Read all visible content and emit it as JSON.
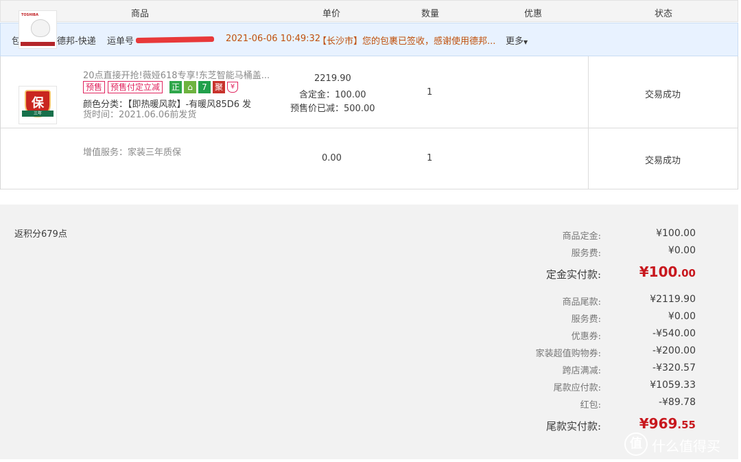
{
  "header": {
    "product": "商品",
    "unit_price": "单价",
    "quantity": "数量",
    "discount": "优惠",
    "status": "状态"
  },
  "package": {
    "name": "包裹1",
    "carrier": "德邦-快递",
    "tracking_label": "运单号",
    "time": "2021-06-06 10:49:32",
    "message": "【长沙市】您的包裹已签收，感谢使用德邦...",
    "more": "更多"
  },
  "items": [
    {
      "title": "20点直接开抢!薇娅618专享!东芝智能马桶盖...",
      "thumb_brand": "TOSHIBA",
      "tags": [
        "预售",
        "预售付定立减"
      ],
      "badges": [
        {
          "text": "正",
          "color": "#2ea64a"
        },
        {
          "text": "⌂",
          "color": "#6db33f"
        },
        {
          "text": "7",
          "color": "#21a04b"
        },
        {
          "text": "聚",
          "color": "#c8332c"
        }
      ],
      "attr_line1": "颜色分类：【即热暖风款】-有暖风85D6 发",
      "attr_line2": "货时间：2021.06.06前发货",
      "price": "2219.90",
      "deposit": "含定金：100.00",
      "presale_off": "预售价已减：500.00",
      "quantity": "1",
      "status": "交易成功"
    },
    {
      "service": "增值服务：家装三年质保",
      "thumb_char": "保",
      "thumb_ribbon": "三年",
      "price": "0.00",
      "quantity": "1",
      "status": "交易成功"
    }
  ],
  "summary": {
    "points": "返积分679点",
    "deposit_goods_label": "商品定金:",
    "deposit_goods_value": "¥100.00",
    "service_fee1_label": "服务费:",
    "service_fee1_value": "¥0.00",
    "deposit_paid_label": "定金实付款:",
    "deposit_paid_int": "¥100",
    "deposit_paid_dec": ".00",
    "balance_goods_label": "商品尾款:",
    "balance_goods_value": "¥2119.90",
    "service_fee2_label": "服务费:",
    "service_fee2_value": "¥0.00",
    "coupon_label": "优惠券:",
    "coupon_value": "-¥540.00",
    "home_coupon_label": "家装超值购物券:",
    "home_coupon_value": "-¥200.00",
    "cross_store_label": "跨店满减:",
    "cross_store_value": "-¥320.57",
    "balance_due_label": "尾款应付款:",
    "balance_due_value": "¥1059.33",
    "red_packet_label": "红包:",
    "red_packet_value": "-¥89.78",
    "balance_paid_label": "尾款实付款:",
    "balance_paid_int": "¥969",
    "balance_paid_dec": ".55"
  },
  "watermark": {
    "logo_char": "值",
    "text": "什么值得买"
  },
  "colors": {
    "accent_red": "#c8181e",
    "orange_text": "#c0510c",
    "package_bg": "#e8f2ff",
    "summary_bg": "#f2f2f2"
  }
}
